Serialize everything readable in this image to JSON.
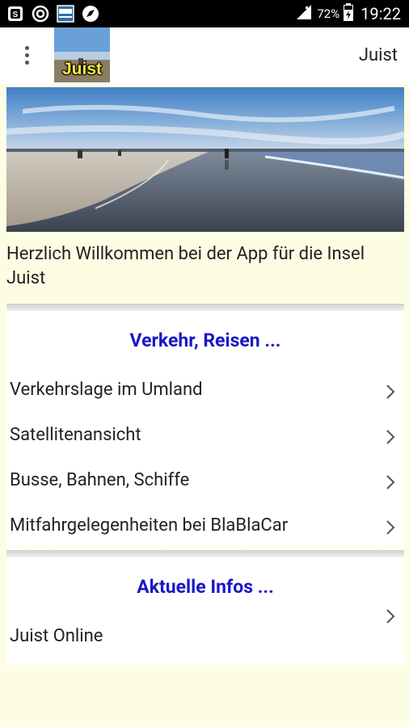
{
  "status_bar": {
    "battery_percent": "72%",
    "time": "19:22",
    "notification_icons": [
      "screenshot-icon",
      "sync-icon",
      "news-app-icon",
      "compass-icon"
    ]
  },
  "app_bar": {
    "logo_text": "Juist",
    "title": "Juist"
  },
  "intro_text": "Herzlich Willkommen bei der App für die Insel Juist",
  "sections": [
    {
      "title": "Verkehr, Reisen ...",
      "items": [
        {
          "label": "Verkehrslage im Umland"
        },
        {
          "label": "Satellitenansicht"
        },
        {
          "label": "Busse, Bahnen, Schiffe"
        },
        {
          "label": "Mitfahrgelegenheiten bei BlaBlaCar"
        }
      ]
    },
    {
      "title": "Aktuelle Infos ...",
      "items": [
        {
          "label": "Juist Online"
        }
      ]
    }
  ],
  "colors": {
    "background": "#fdfde4",
    "section_title": "#1a17c8",
    "logo_text": "#ffeb3b"
  }
}
